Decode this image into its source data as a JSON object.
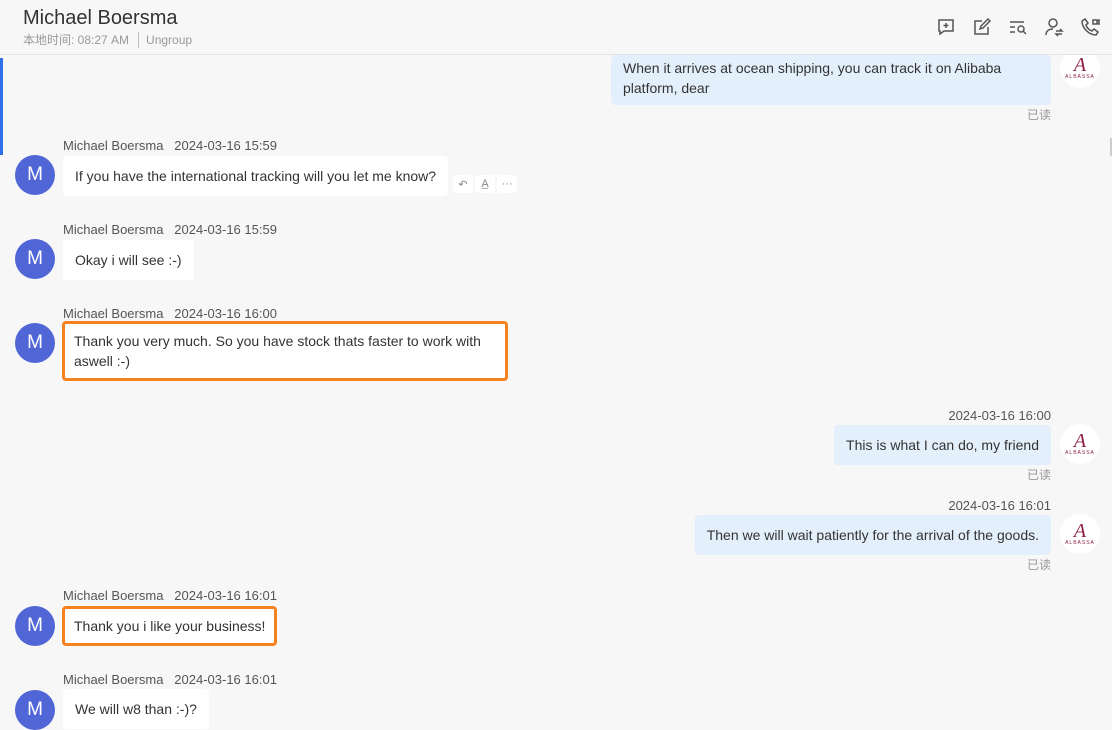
{
  "header": {
    "title": "Michael Boersma",
    "local_time": "本地时间: 08:27 AM",
    "group": "Ungroup",
    "icons": [
      "add-chat-icon",
      "edit-icon",
      "search-messages-icon",
      "transfer-contact-icon",
      "call-icon"
    ]
  },
  "avatar_letter": "M",
  "brand": {
    "name": "ALBASSA",
    "letter": "A",
    "color": "#8e2040"
  },
  "read_label": "已读",
  "hover_actions": [
    "reply-icon",
    "translate-icon",
    "more-icon"
  ],
  "more_glyph": "···",
  "messages": [
    {
      "dir": "out",
      "text": "When it arrives at ocean shipping, you can track it on Alibaba platform, dear"
    },
    {
      "dir": "in",
      "sender": "Michael Boersma",
      "time": "2024-03-16 15:59",
      "text": "If you have the international tracking will you let me know?"
    },
    {
      "dir": "in",
      "sender": "Michael Boersma",
      "time": "2024-03-16 15:59",
      "text": "Okay i will see :-)"
    },
    {
      "dir": "in",
      "sender": "Michael Boersma",
      "time": "2024-03-16 16:00",
      "text": "Thank you very much. So you have stock thats faster to work with aswell :-)",
      "highlighted": true
    },
    {
      "dir": "out",
      "time": "2024-03-16 16:00",
      "text": "This is what I can do, my friend"
    },
    {
      "dir": "out",
      "time": "2024-03-16 16:01",
      "text": "Then we will wait patiently for the arrival of the goods."
    },
    {
      "dir": "in",
      "sender": "Michael Boersma",
      "time": "2024-03-16 16:01",
      "text": "Thank you i like your business!",
      "highlighted": true
    },
    {
      "dir": "in",
      "sender": "Michael Boersma",
      "time": "2024-03-16 16:01",
      "text": "We will w8 than :-)?"
    }
  ],
  "colors": {
    "accent": "#2f6fe8",
    "avatar": "#5166d6",
    "outgoing_bubble": "#e4effc",
    "highlight": "#f5821f"
  }
}
